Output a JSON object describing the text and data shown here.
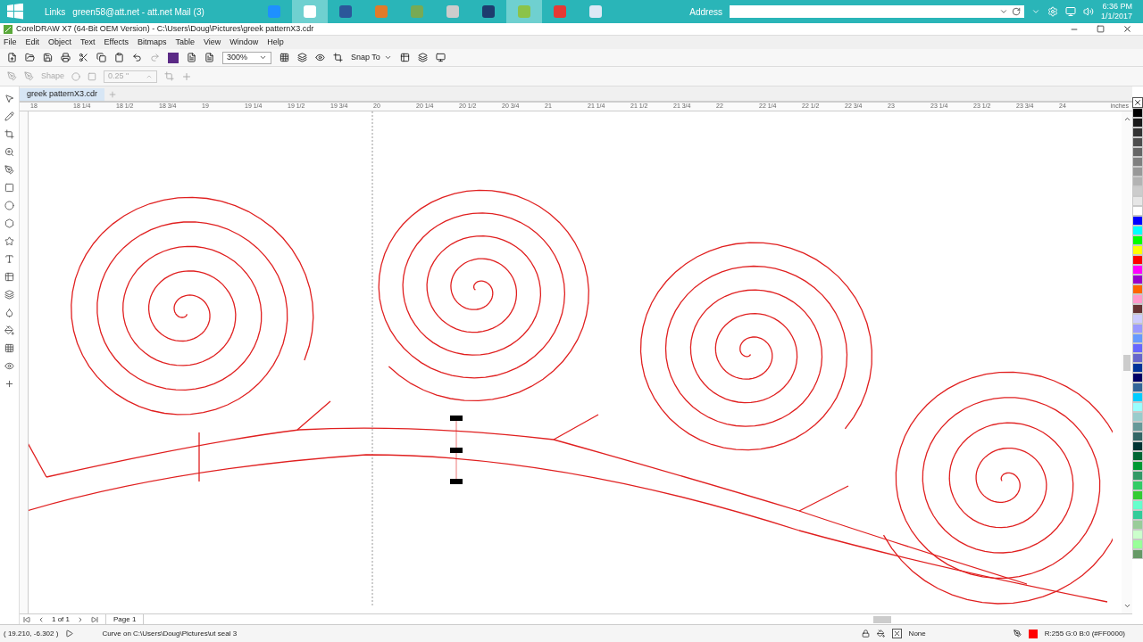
{
  "taskbar": {
    "links": "Links",
    "mail": "green58@att.net - att.net Mail (3)",
    "apps": [
      {
        "selected": false
      },
      {
        "selected": true
      },
      {
        "selected": false
      },
      {
        "selected": false
      },
      {
        "selected": false
      },
      {
        "selected": false
      },
      {
        "selected": false
      },
      {
        "selected": true
      },
      {
        "selected": false
      },
      {
        "selected": false
      }
    ],
    "address_label": "Address",
    "time": "6:36 PM",
    "date": "1/1/2017"
  },
  "window": {
    "title": "CorelDRAW X7 (64-Bit OEM Version) - C:\\Users\\Doug\\Pictures\\greek patternX3.cdr"
  },
  "menu": [
    "File",
    "Edit",
    "Object",
    "Text",
    "Effects",
    "Bitmaps",
    "Table",
    "View",
    "Window",
    "Help"
  ],
  "toolbar": {
    "zoom": "300%",
    "snap": "Snap To"
  },
  "property_bar": {
    "shape_label": "Shape",
    "outline_width": "0.25 \""
  },
  "document_tab": {
    "label": "greek patternX3.cdr",
    "selected": true
  },
  "ruler": {
    "labels": [
      "18",
      "18 1/4",
      "18 1/2",
      "18 3/4",
      "19",
      "19 1/4",
      "19 1/2",
      "19 3/4",
      "20",
      "20 1/4",
      "20 1/2",
      "20 3/4",
      "21",
      "21 1/4",
      "21 1/2",
      "21 3/4",
      "22",
      "22 1/4",
      "22 1/2",
      "22 3/4",
      "23",
      "23 1/4",
      "23 1/2",
      "23 3/4",
      "24"
    ],
    "unit": "inches"
  },
  "palette": [
    {
      "color": "#000000"
    },
    {
      "color": "#1a1a1a"
    },
    {
      "color": "#333333"
    },
    {
      "color": "#4d4d4d"
    },
    {
      "color": "#666666"
    },
    {
      "color": "#808080"
    },
    {
      "color": "#999999"
    },
    {
      "color": "#b3b3b3"
    },
    {
      "color": "#cccccc"
    },
    {
      "color": "#e6e6e6"
    },
    {
      "color": "#ffffff"
    },
    {
      "color": "#0000ff"
    },
    {
      "color": "#00ffff"
    },
    {
      "color": "#00ff00"
    },
    {
      "color": "#ffff00"
    },
    {
      "color": "#ff0000"
    },
    {
      "color": "#ff00ff"
    },
    {
      "color": "#9900cc"
    },
    {
      "color": "#ff6600"
    },
    {
      "color": "#ff99cc"
    },
    {
      "color": "#663333"
    },
    {
      "color": "#ccccff"
    },
    {
      "color": "#9999ff"
    },
    {
      "color": "#6699ff"
    },
    {
      "color": "#6666ff"
    },
    {
      "color": "#6666cc"
    },
    {
      "color": "#003399"
    },
    {
      "color": "#000066"
    },
    {
      "color": "#336699"
    },
    {
      "color": "#00ccff"
    },
    {
      "color": "#99ffff"
    },
    {
      "color": "#99cccc"
    },
    {
      "color": "#669999"
    },
    {
      "color": "#336666"
    },
    {
      "color": "#003333"
    },
    {
      "color": "#006633"
    },
    {
      "color": "#009933"
    },
    {
      "color": "#339966"
    },
    {
      "color": "#33cc66"
    },
    {
      "color": "#33cc33"
    },
    {
      "color": "#66ffcc"
    },
    {
      "color": "#33cc99"
    },
    {
      "color": "#99cc99"
    },
    {
      "color": "#ccffcc"
    },
    {
      "color": "#99ff99"
    },
    {
      "color": "#669966"
    }
  ],
  "page_nav": {
    "count": "1 of 1",
    "page_tab": "Page 1"
  },
  "status_bar": {
    "coordinates": "( 19.210, -6.302 )",
    "message": "Curve on C:\\Users\\Doug\\Pictures\\ut seal 3",
    "fill": "None",
    "outline": {
      "text": "R:255 G:0 B:0 (#FF0000)",
      "color": "#ff0000"
    }
  }
}
